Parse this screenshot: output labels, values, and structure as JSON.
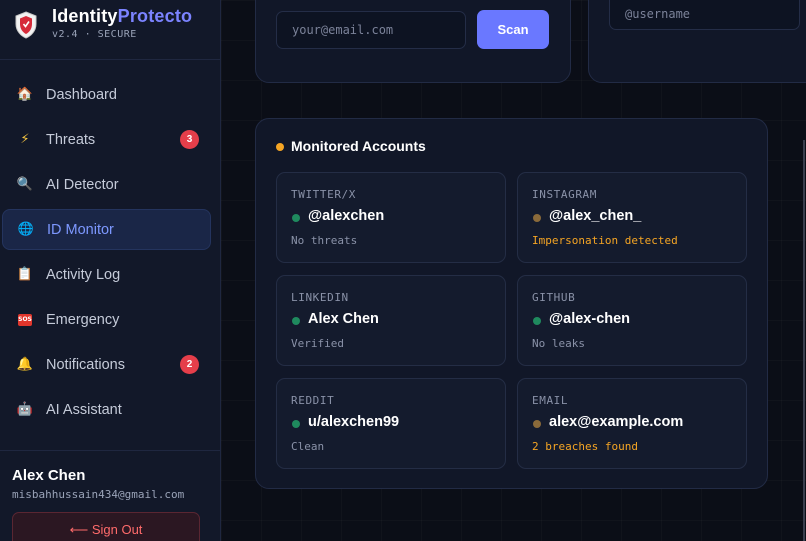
{
  "brand": {
    "title_part1": "Identity",
    "title_part2": "Protecto",
    "subtitle": "v2.4 · SECURE",
    "logo_icon": "shield-icon"
  },
  "sidebar": {
    "items": [
      {
        "label": "Dashboard",
        "icon": "house-icon",
        "active": false
      },
      {
        "label": "Threats",
        "icon": "lightning-icon",
        "badge": "3",
        "active": false
      },
      {
        "label": "AI Detector",
        "icon": "magnifier-icon",
        "active": false
      },
      {
        "label": "ID Monitor",
        "icon": "globe-icon",
        "active": true
      },
      {
        "label": "Activity Log",
        "icon": "clipboard-icon",
        "active": false
      },
      {
        "label": "Emergency",
        "icon": "sos-icon",
        "active": false
      },
      {
        "label": "Notifications",
        "icon": "bell-icon",
        "badge": "2",
        "active": false
      },
      {
        "label": "AI Assistant",
        "icon": "robot-icon",
        "active": false
      }
    ]
  },
  "user": {
    "name": "Alex Chen",
    "email": "misbahhussain434@gmail.com",
    "signout_label": "⟵ Sign Out"
  },
  "scan": {
    "email_placeholder": "your@email.com",
    "scan_label": "Scan",
    "username_placeholder": "@username"
  },
  "monitored": {
    "title": "Monitored Accounts",
    "accounts": [
      {
        "platform": "TWITTER/X",
        "handle": "@alexchen",
        "status": "No threats",
        "status_color": "#8a92a8",
        "dot_color": "#1f8a5e"
      },
      {
        "platform": "INSTAGRAM",
        "handle": "@alex_chen_",
        "status": "Impersonation detected",
        "status_color": "#f5a524",
        "dot_color": "#8a6a3a"
      },
      {
        "platform": "LINKEDIN",
        "handle": "Alex Chen",
        "status": "Verified",
        "status_color": "#8a92a8",
        "dot_color": "#1f8a5e"
      },
      {
        "platform": "GITHUB",
        "handle": "@alex-chen",
        "status": "No leaks",
        "status_color": "#8a92a8",
        "dot_color": "#1f8a5e"
      },
      {
        "platform": "REDDIT",
        "handle": "u/alexchen99",
        "status": "Clean",
        "status_color": "#8a92a8",
        "dot_color": "#1f8a5e"
      },
      {
        "platform": "EMAIL",
        "handle": "alex@example.com",
        "status": "2 breaches found",
        "status_color": "#f5a524",
        "dot_color": "#8a6a3a"
      }
    ]
  },
  "colors": {
    "accent": "#7b83ff",
    "active_nav": "#7d98ff",
    "danger": "#e53e4a",
    "warning": "#f5a524",
    "success": "#1f8a5e"
  }
}
